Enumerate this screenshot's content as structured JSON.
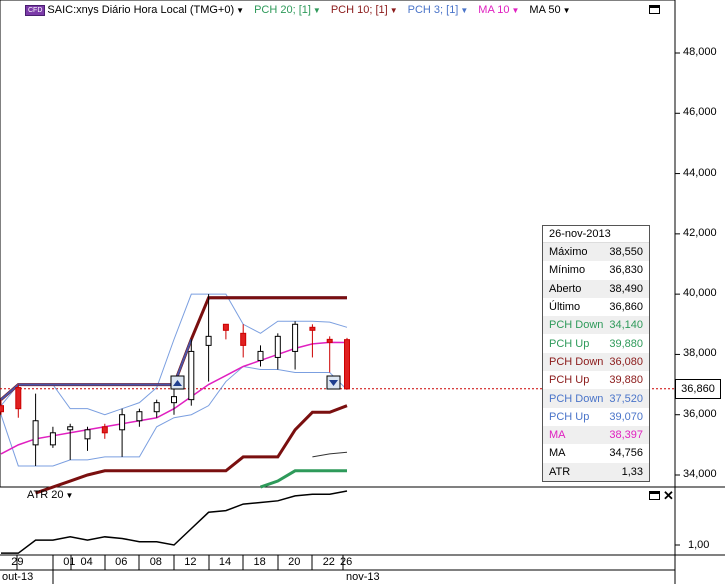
{
  "header": {
    "cfd_badge": "CFD",
    "symbol_label": "SAIC:xnys Diário Hora Local (TMG+0)",
    "indicators": [
      {
        "label": "PCH 20; [1]",
        "color": "#2e9a5a"
      },
      {
        "label": "PCH 10; [1]",
        "color": "#8b1a1a"
      },
      {
        "label": "PCH 3; [1]",
        "color": "#4a74c9"
      },
      {
        "label": "MA 10",
        "color": "#e020c0"
      },
      {
        "label": "MA 50",
        "color": "#000000"
      }
    ]
  },
  "price_axis": {
    "ticks": [
      "48,000",
      "46,000",
      "44,000",
      "42,000",
      "40,000",
      "38,000",
      "36,000",
      "34,000"
    ],
    "last_price": "36,860"
  },
  "info": {
    "date": "26-nov-2013",
    "rows": [
      {
        "label": "Máximo",
        "value": "38,550",
        "color": "#000000"
      },
      {
        "label": "Mínimo",
        "value": "36,830",
        "color": "#000000"
      },
      {
        "label": "Aberto",
        "value": "38,490",
        "color": "#000000"
      },
      {
        "label": "Último",
        "value": "36,860",
        "color": "#000000"
      },
      {
        "label": "PCH Down",
        "value": "34,140",
        "color": "#2e9a5a"
      },
      {
        "label": "PCH Up",
        "value": "39,880",
        "color": "#2e9a5a"
      },
      {
        "label": "PCH Down",
        "value": "36,080",
        "color": "#8b1a1a"
      },
      {
        "label": "PCH Up",
        "value": "39,880",
        "color": "#8b1a1a"
      },
      {
        "label": "PCH Down",
        "value": "37,520",
        "color": "#4a74c9"
      },
      {
        "label": "PCH Up",
        "value": "39,070",
        "color": "#4a74c9"
      },
      {
        "label": "MA",
        "value": "38,397",
        "color": "#e020c0"
      },
      {
        "label": "MA",
        "value": "34,756",
        "color": "#000000"
      },
      {
        "label": "ATR",
        "value": "1,33",
        "color": "#000000"
      }
    ]
  },
  "atr": {
    "label": "ATR 20",
    "axis_value": "1,00"
  },
  "x_axis": {
    "days": [
      "29",
      "01",
      "04",
      "06",
      "08",
      "12",
      "14",
      "18",
      "20",
      "22",
      "26"
    ],
    "months": [
      "out-13",
      "nov-13"
    ]
  },
  "chart_data": {
    "type": "candlestick",
    "dates": [
      "28",
      "29",
      "30",
      "31",
      "01",
      "04",
      "05",
      "06",
      "07",
      "08",
      "11",
      "12",
      "13",
      "14",
      "15",
      "18",
      "19",
      "20",
      "21",
      "22",
      "25",
      "26"
    ],
    "candles": [
      {
        "o": 36.3,
        "h": 36.5,
        "l": 36.0,
        "c": 36.1
      },
      {
        "o": 36.9,
        "h": 37.0,
        "l": 35.9,
        "c": 36.2
      },
      {
        "o": 35.0,
        "h": 36.7,
        "l": 34.3,
        "c": 35.8
      },
      {
        "o": 35.0,
        "h": 35.6,
        "l": 34.9,
        "c": 35.4
      },
      {
        "o": 35.5,
        "h": 35.7,
        "l": 34.5,
        "c": 35.6
      },
      {
        "o": 35.2,
        "h": 35.6,
        "l": 34.8,
        "c": 35.5
      },
      {
        "o": 35.6,
        "h": 35.7,
        "l": 35.2,
        "c": 35.4
      },
      {
        "o": 35.5,
        "h": 36.2,
        "l": 34.6,
        "c": 36.0
      },
      {
        "o": 35.8,
        "h": 36.2,
        "l": 35.6,
        "c": 36.1
      },
      {
        "o": 36.1,
        "h": 36.5,
        "l": 35.9,
        "c": 36.4
      },
      {
        "o": 36.4,
        "h": 36.9,
        "l": 36.0,
        "c": 36.6
      },
      {
        "o": 36.5,
        "h": 38.5,
        "l": 36.3,
        "c": 38.1
      },
      {
        "o": 38.3,
        "h": 40.0,
        "l": 37.1,
        "c": 38.6
      },
      {
        "o": 39.0,
        "h": 39.0,
        "l": 38.5,
        "c": 38.8
      },
      {
        "o": 38.7,
        "h": 39.0,
        "l": 37.9,
        "c": 38.3
      },
      {
        "o": 37.8,
        "h": 38.3,
        "l": 37.6,
        "c": 38.1
      },
      {
        "o": 37.9,
        "h": 38.7,
        "l": 37.5,
        "c": 38.6
      },
      {
        "o": 38.1,
        "h": 39.1,
        "l": 37.5,
        "c": 39.0
      },
      {
        "o": 38.9,
        "h": 39.0,
        "l": 37.9,
        "c": 38.8
      },
      {
        "o": 38.5,
        "h": 38.6,
        "l": 37.4,
        "c": 38.4
      },
      {
        "o": 38.49,
        "h": 38.55,
        "l": 36.83,
        "c": 36.86
      }
    ],
    "last_price": 36.86,
    "price_ylim": [
      33.5,
      49.5
    ],
    "pch20_up": [
      null,
      null,
      null,
      null,
      null,
      null,
      null,
      null,
      null,
      null,
      null,
      null,
      39.88,
      39.88,
      39.88,
      39.88,
      39.88,
      39.88,
      39.88,
      39.88,
      39.88
    ],
    "pch20_down": [
      null,
      null,
      null,
      null,
      null,
      null,
      null,
      null,
      null,
      null,
      null,
      null,
      null,
      null,
      null,
      33.6,
      33.8,
      34.14,
      34.14,
      34.14,
      34.14
    ],
    "pch10_up": [
      36.5,
      37.0,
      37.0,
      37.0,
      37.0,
      37.0,
      37.0,
      37.0,
      37.0,
      37.0,
      37.0,
      38.5,
      39.88,
      39.88,
      39.88,
      39.88,
      39.88,
      39.88,
      39.88,
      39.88,
      39.88
    ],
    "pch10_down": [
      null,
      null,
      33.4,
      33.6,
      33.8,
      34.0,
      34.14,
      34.14,
      34.14,
      34.14,
      34.14,
      34.14,
      34.14,
      34.14,
      34.6,
      34.6,
      34.6,
      35.5,
      36.08,
      36.08,
      36.3
    ],
    "pch3_up": [
      36.3,
      37.0,
      37.0,
      37.0,
      36.2,
      36.2,
      36.0,
      36.2,
      36.4,
      36.9,
      38.5,
      40.0,
      40.0,
      40.0,
      39.0,
      38.7,
      39.1,
      39.1,
      39.1,
      39.07,
      38.9
    ],
    "pch3_down": [
      36.0,
      34.3,
      34.3,
      34.3,
      34.5,
      34.5,
      34.6,
      34.6,
      34.6,
      35.6,
      35.9,
      36.0,
      36.3,
      37.1,
      37.6,
      37.5,
      37.5,
      37.4,
      37.4,
      37.4,
      36.83
    ],
    "ma10": [
      34.7,
      35.0,
      35.2,
      35.3,
      35.4,
      35.5,
      35.6,
      35.7,
      35.8,
      35.9,
      36.2,
      36.6,
      37.0,
      37.3,
      37.6,
      37.8,
      38.0,
      38.2,
      38.35,
      38.4,
      38.397
    ],
    "ma50": [
      null,
      null,
      null,
      null,
      null,
      null,
      null,
      null,
      null,
      null,
      null,
      null,
      null,
      null,
      null,
      null,
      null,
      null,
      34.6,
      34.7,
      34.756
    ],
    "atr20": [
      0.95,
      0.95,
      1.03,
      1.03,
      1.05,
      1.03,
      1.05,
      1.04,
      1.02,
      1.02,
      1.0,
      1.1,
      1.2,
      1.21,
      1.25,
      1.26,
      1.27,
      1.3,
      1.31,
      1.31,
      1.33
    ]
  }
}
